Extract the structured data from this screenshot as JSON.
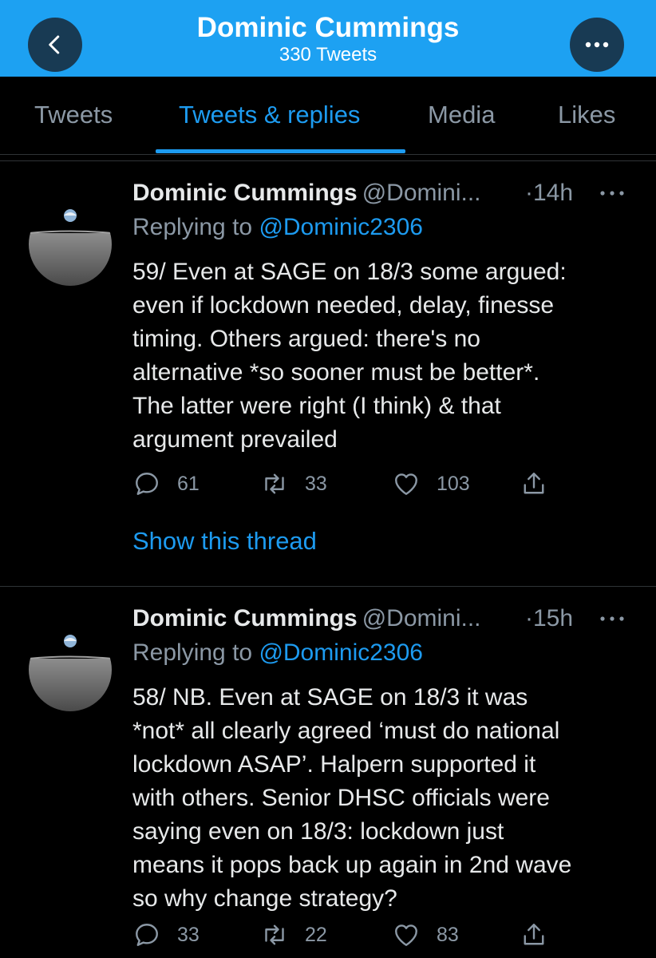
{
  "header": {
    "title": "Dominic Cummings",
    "subtitle": "330 Tweets",
    "back_icon": "chevron-left-icon",
    "more_icon": "more-horizontal-icon",
    "bar_color": "#1da1f2"
  },
  "tabs": [
    {
      "label": "Tweets",
      "active": false
    },
    {
      "label": "Tweets & replies",
      "active": true
    },
    {
      "label": "Media",
      "active": false
    },
    {
      "label": "Likes",
      "active": false
    }
  ],
  "tweets": [
    {
      "name": "Dominic Cummings",
      "handle": "@Domini...",
      "time": "·14h",
      "replying_prefix": "Replying to",
      "replying_to": "@Dominic2306",
      "text": "59/ Even at SAGE on 18/3 some argued:\neven if lockdown needed, delay, finesse\ntiming. Others argued: there's no\nalternative *so sooner must be better*.\nThe latter were right (I think) & that\nargument prevailed",
      "replies": "61",
      "retweets": "33",
      "likes": "103",
      "show_thread": "Show this thread"
    },
    {
      "name": "Dominic Cummings",
      "handle": "@Domini...",
      "time": "·15h",
      "replying_prefix": "Replying to",
      "replying_to": "@Dominic2306",
      "text": "58/ NB. Even at SAGE on 18/3 it was\n*not* all clearly agreed ‘must do national\nlockdown ASAP’. Halpern supported it\nwith others. Senior DHSC officials were\nsaying even on 18/3: lockdown just\nmeans it pops back up again in 2nd wave\nso why change strategy?",
      "replies": "33",
      "retweets": "22",
      "likes": "83"
    }
  ],
  "colors": {
    "accent": "#1d9bf0",
    "secondary_text": "#8b98a5",
    "background": "#000000"
  }
}
